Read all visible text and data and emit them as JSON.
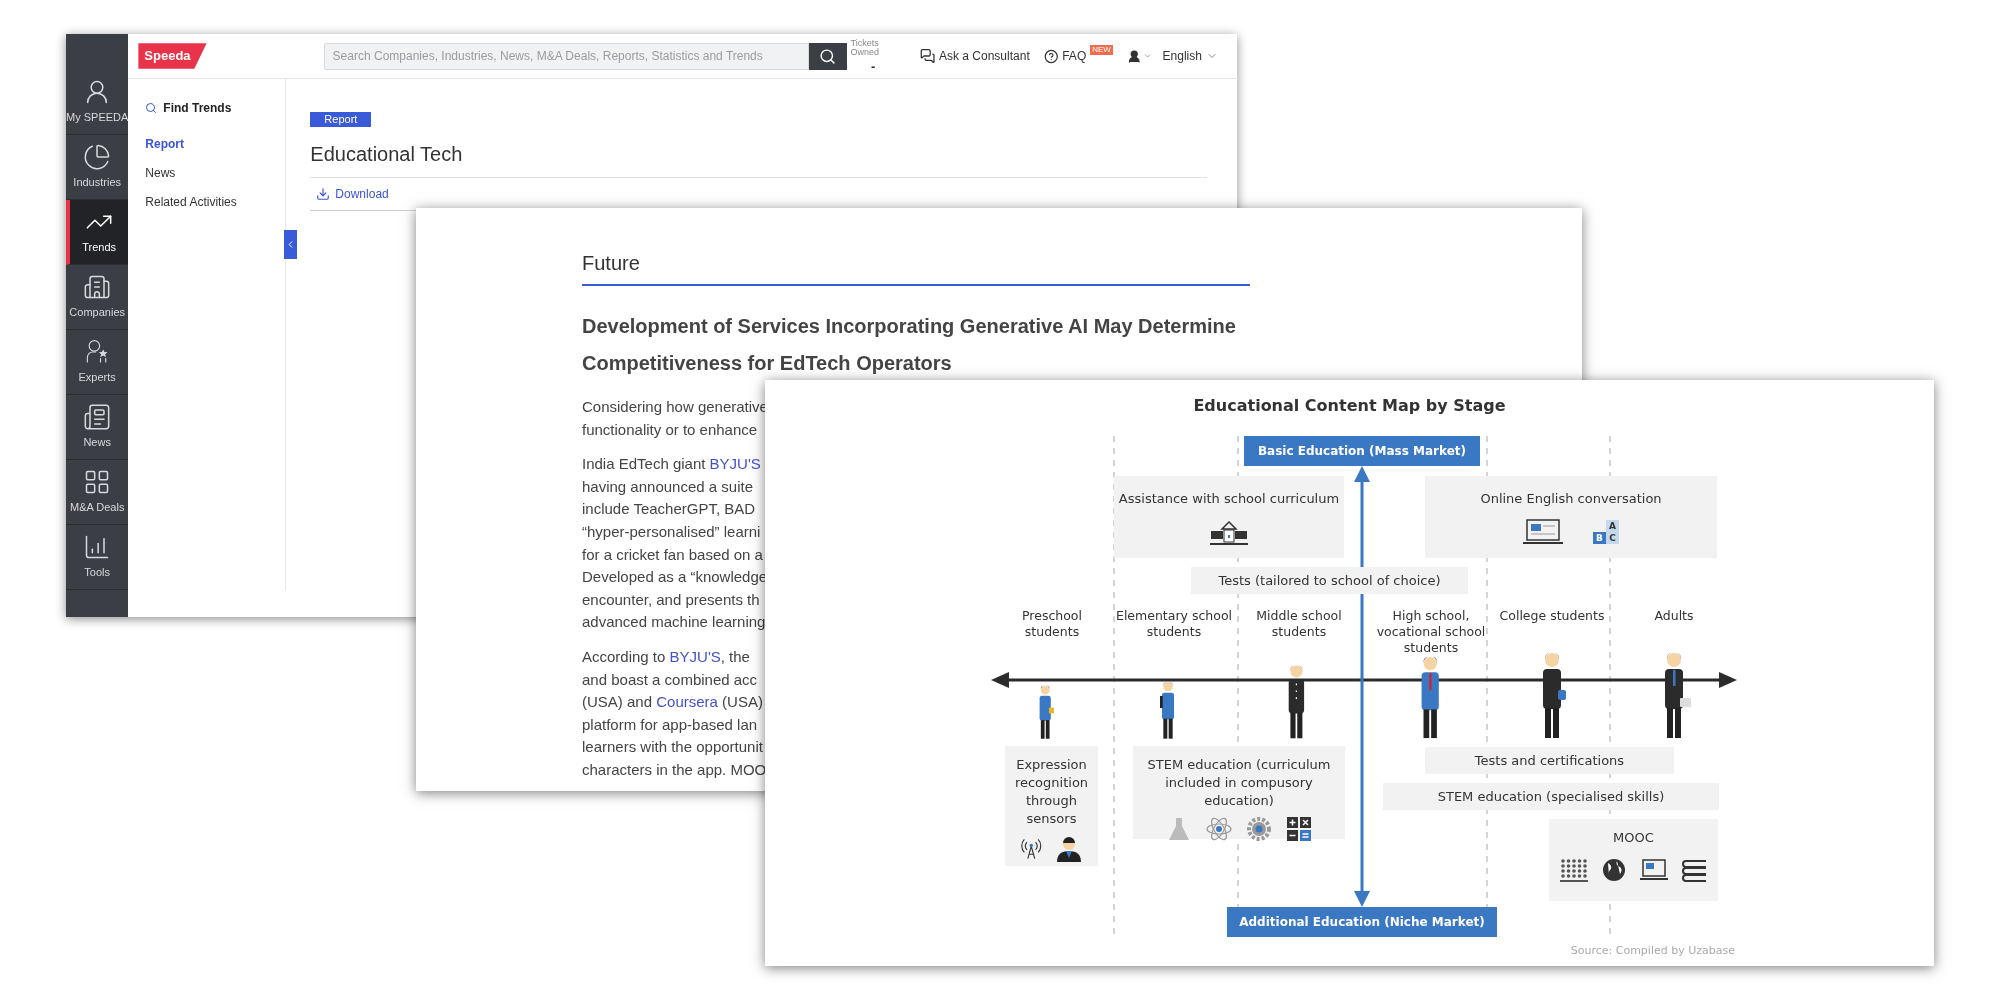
{
  "app_window": {
    "logo": "Speeda",
    "search": {
      "placeholder": "Search Companies, Industries, News, M&A Deals, Reports, Statistics and Trends"
    },
    "tickets": {
      "label": "Tickets Owned",
      "value": "-"
    },
    "consultant_link": "Ask a Consultant",
    "faq_link": "FAQ",
    "faq_badge": "NEW",
    "language": "English",
    "rail": [
      {
        "label": "My SPEEDA",
        "selected": false
      },
      {
        "label": "Industries",
        "selected": false
      },
      {
        "label": "Trends",
        "selected": true
      },
      {
        "label": "Companies",
        "selected": false
      },
      {
        "label": "Experts",
        "selected": false
      },
      {
        "label": "News",
        "selected": false
      },
      {
        "label": "M&A Deals",
        "selected": false
      },
      {
        "label": "Tools",
        "selected": false
      }
    ],
    "sidebar": {
      "title": "Find Trends",
      "items": [
        {
          "label": "Report",
          "selected": true
        },
        {
          "label": "News",
          "selected": false
        },
        {
          "label": "Related Activities",
          "selected": false
        }
      ]
    },
    "report_badge": "Report",
    "title": "Educational Tech",
    "download": "Download"
  },
  "report_page": {
    "section": "Future",
    "heading": [
      "Development of Services Incorporating Generative AI May Determine",
      "Competitiveness for EdTech Operators"
    ],
    "paragraphs": [
      [
        [
          {
            "text": "Considering how generative",
            "link": false
          }
        ],
        [
          {
            "text": "functionality or to enhance",
            "link": false
          }
        ]
      ],
      [
        [
          {
            "text": "India EdTech giant ",
            "link": false
          },
          {
            "text": "BYJU'S",
            "link": true
          }
        ],
        [
          {
            "text": "having announced a suite",
            "link": false
          }
        ],
        [
          {
            "text": "include TeacherGPT, BAD",
            "link": false
          }
        ],
        [
          {
            "text": "“hyper-personalised” learni",
            "link": false
          }
        ],
        [
          {
            "text": "for a cricket fan based on a",
            "link": false
          }
        ],
        [
          {
            "text": "Developed as a “knowledge",
            "link": false
          }
        ],
        [
          {
            "text": "encounter, and presents th",
            "link": false
          }
        ],
        [
          {
            "text": "advanced machine learning",
            "link": false
          }
        ]
      ],
      [
        [
          {
            "text": "According to ",
            "link": false
          },
          {
            "text": "BYJU'S",
            "link": true
          },
          {
            "text": ", the",
            "link": false
          }
        ],
        [
          {
            "text": "and boast a combined acc",
            "link": false
          }
        ],
        [
          {
            "text": "(USA) and ",
            "link": false
          },
          {
            "text": "Coursera",
            "link": true
          },
          {
            "text": " (USA)",
            "link": false
          }
        ],
        [
          {
            "text": "platform for app-based lan",
            "link": false
          }
        ],
        [
          {
            "text": "learners with the opportunit",
            "link": false
          }
        ],
        [
          {
            "text": "characters in the app. MOO",
            "link": false
          }
        ]
      ]
    ]
  },
  "diagram": {
    "title": "Educational Content Map by Stage",
    "top_label": "Basic Education (Mass Market)",
    "bottom_label": "Additional Education (Niche Market)",
    "stages": [
      "Preschool students",
      "Elementary school students",
      "Middle school students",
      "High school, vocational school students",
      "College students",
      "Adults"
    ],
    "upper_boxes": [
      "Assistance with school curriculum",
      "Online English conversation"
    ],
    "letters": [
      "A",
      "B",
      "C"
    ],
    "choice_tests": "Tests (tailored to school of choice)",
    "lower_boxes": [
      "Expression recognition through sensors",
      "STEM education (curriculum included in compusory education)",
      "Tests and certifications",
      "STEM education (specialised skills)",
      "MOOC"
    ],
    "source": "Source: Compiled by Uzabase"
  }
}
